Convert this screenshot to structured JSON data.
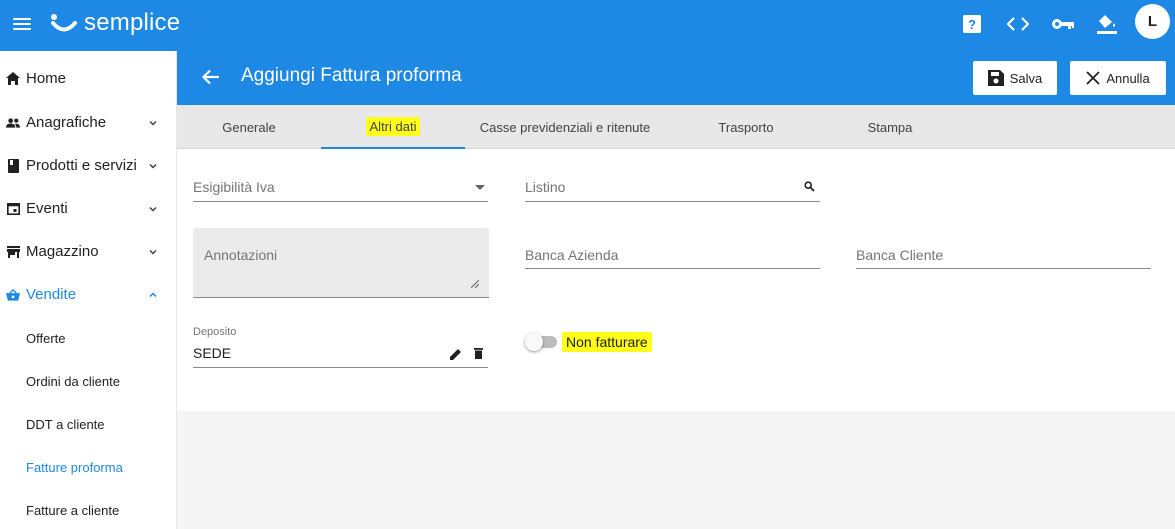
{
  "app": {
    "name": "semplice",
    "user_initial": "L",
    "primary_color": "#1e88e5",
    "highlight_color": "#ffff1a",
    "top_icons": [
      "help-icon",
      "code-icon",
      "key-icon",
      "paint-bucket-icon"
    ],
    "help_glyph": "?"
  },
  "sidebar": {
    "items": [
      {
        "label": "Home",
        "icon": "home-icon"
      },
      {
        "label": "Anagrafiche",
        "icon": "people-icon"
      },
      {
        "label": "Prodotti e servizi",
        "icon": "book-icon"
      },
      {
        "label": "Eventi",
        "icon": "calendar-icon"
      },
      {
        "label": "Magazzino",
        "icon": "store-icon"
      },
      {
        "label": "Vendite",
        "icon": "basket-icon"
      }
    ],
    "sub_items": [
      {
        "label": "Offerte"
      },
      {
        "label": "Ordini da cliente"
      },
      {
        "label": "DDT a cliente"
      },
      {
        "label": "Fatture proforma"
      },
      {
        "label": "Fatture a cliente"
      }
    ]
  },
  "header": {
    "title": "Aggiungi Fattura proforma",
    "save_label": "Salva",
    "cancel_label": "Annulla"
  },
  "tabs": [
    {
      "label": "Generale"
    },
    {
      "label": "Altri dati"
    },
    {
      "label": "Casse previdenziali e ritenute"
    },
    {
      "label": "Trasporto"
    },
    {
      "label": "Stampa"
    }
  ],
  "form": {
    "esigibilita_iva": {
      "placeholder": "Esigibilità Iva"
    },
    "listino": {
      "placeholder": "Listino"
    },
    "annotazioni": {
      "placeholder": "Annotazioni"
    },
    "banca_azienda": {
      "placeholder": "Banca Azienda"
    },
    "banca_cliente": {
      "placeholder": "Banca Cliente"
    },
    "deposito": {
      "label": "Deposito",
      "value": "SEDE"
    },
    "non_fatturare": {
      "label": "Non fatturare"
    }
  }
}
